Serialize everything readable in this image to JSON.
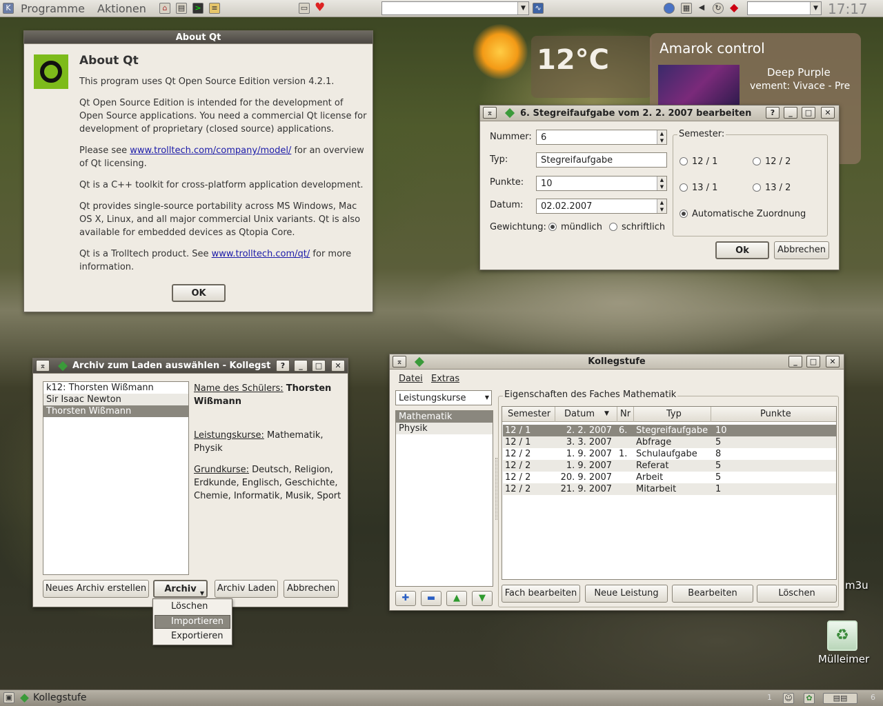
{
  "top_panel": {
    "menus": [
      "Programme",
      "Aktionen"
    ],
    "clock": "17:17",
    "icons": [
      "kmenu-icon",
      "home-icon",
      "clapper-icon",
      "terminal-icon",
      "notes-icon",
      "floppy-icon",
      "heart-icon",
      "sysmon-icon",
      "kopete-icon",
      "clipboard-icon",
      "volume-icon",
      "network-icon",
      "ruby-icon"
    ]
  },
  "weather": {
    "temperature": "12°C"
  },
  "amarok": {
    "title": "Amarok control",
    "artist": "Deep Purple",
    "track": "vement: Vivace - Pre"
  },
  "about_qt": {
    "window_title": "About Qt",
    "heading": "About Qt",
    "p1": "This program uses Qt Open Source Edition version 4.2.1.",
    "p2": "Qt Open Source Edition is intended for the development of Open Source applications. You need a commercial Qt license for development of proprietary (closed source) applications.",
    "p3_pre": "Please see ",
    "p3_link": "www.trolltech.com/company/model/",
    "p3_post": " for an overview of Qt licensing.",
    "p4": "Qt is a C++ toolkit for cross-platform application development.",
    "p5": "Qt provides single-source portability across MS  Windows, Mac  OS  X, Linux, and all major commercial Unix variants. Qt is also available for embedded devices as Qtopia Core.",
    "p6_pre": "Qt is a Trolltech product. See ",
    "p6_link": "www.trolltech.com/qt/",
    "p6_post": " for more information.",
    "ok": "OK"
  },
  "edit_dialog": {
    "title": "6. Stegreifaufgabe vom  2.  2. 2007 bearbeiten",
    "nummer_label": "Nummer:",
    "nummer": "6",
    "typ_label": "Typ:",
    "typ": "Stegreifaufgabe",
    "punkte_label": "Punkte:",
    "punkte": "10",
    "datum_label": "Datum:",
    "datum": "02.02.2007",
    "gewichtung_label": "Gewichtung:",
    "muendlich": "mündlich",
    "schriftlich": "schriftlich",
    "semester_label": "Semester:",
    "sem": [
      "12 / 1",
      "12 / 2",
      "13 / 1",
      "13 / 2"
    ],
    "auto": "Automatische Zuordnung",
    "ok": "Ok",
    "cancel": "Abbrechen"
  },
  "archive_dialog": {
    "title": "Archiv zum Laden auswählen - Kollegst",
    "items": [
      "k12: Thorsten Wißmann",
      "Sir Isaac Newton",
      "Thorsten Wißmann"
    ],
    "name_label": "Name des Schülers:",
    "name": "Thorsten Wißmann",
    "lk_label": "Leistungskurse:",
    "lk": "Mathematik, Physik",
    "gk_label": "Grundkurse:",
    "gk": "Deutsch, Religion, Erdkunde, Englisch, Geschichte, Chemie, Informatik, Musik, Sport",
    "btn_new": "Neues Archiv erstellen",
    "btn_archiv": "Archiv",
    "btn_load": "Archiv Laden",
    "btn_cancel": "Abbrechen",
    "menu": [
      "Löschen",
      "Importieren",
      "Exportieren"
    ]
  },
  "kollegstufe": {
    "title": "Kollegstufe",
    "menus": [
      "Datei",
      "Extras"
    ],
    "combo": "Leistungskurse",
    "subjects": [
      "Mathematik",
      "Physik"
    ],
    "group_label": "Eigenschaften des Faches Mathematik",
    "columns": [
      "Semester",
      "Datum",
      "Nr",
      "Typ",
      "Punkte"
    ],
    "rows": [
      [
        "12 / 1",
        "2.  2. 2007",
        "6.",
        "Stegreifaufgabe",
        "10"
      ],
      [
        "12 / 1",
        "3.  3. 2007",
        "",
        "Abfrage",
        "5"
      ],
      [
        "12 / 2",
        "1.  9. 2007",
        "1.",
        "Schulaufgabe",
        "8"
      ],
      [
        "12 / 2",
        "1.  9. 2007",
        "",
        "Referat",
        "5"
      ],
      [
        "12 / 2",
        "20.  9. 2007",
        "",
        "Arbeit",
        "5"
      ],
      [
        "12 / 2",
        "21.  9. 2007",
        "",
        "Mitarbeit",
        "1"
      ]
    ],
    "btn_fach": "Fach bearbeiten",
    "btn_neu": "Neue Leistung",
    "btn_bearb": "Bearbeiten",
    "btn_loeschen": "Löschen"
  },
  "desktop": {
    "trash": "Mülleimer",
    "m3u": "m3u"
  },
  "taskbar": {
    "task": "Kollegstufe",
    "pager": [
      "1",
      "6"
    ]
  }
}
